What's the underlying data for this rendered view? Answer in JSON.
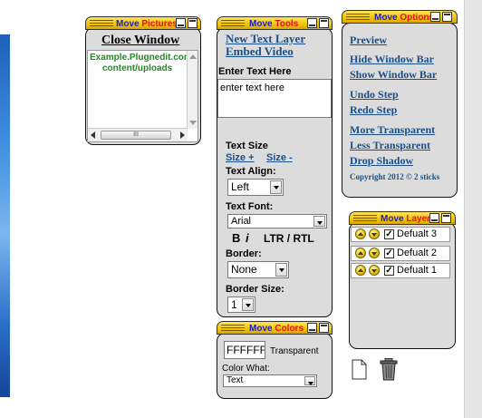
{
  "pictures_panel": {
    "title_move": "Move",
    "title_name": "Pictures",
    "close_window": "Close Window",
    "url_line1": "Example.Plugnedit.con",
    "url_line2": "content/uploads",
    "scroll_thumb": "III"
  },
  "tools_panel": {
    "title_move": "Move",
    "title_name": "Tools",
    "new_text_layer": "New Text Layer",
    "embed_video": "Embed Video",
    "enter_text_label": "Enter Text Here",
    "textarea_value": "enter text here",
    "text_size_label": "Text Size",
    "size_plus": "Size +",
    "size_minus": "Size -",
    "text_align_label": "Text Align:",
    "align_value": "Left",
    "text_font_label": "Text Font:",
    "font_value": "Arial",
    "bold": "B",
    "italic": "i",
    "ltr_rtl": "LTR / RTL",
    "border_label": "Border:",
    "border_value": "None",
    "border_size_label": "Border Size:",
    "border_size_value": "1"
  },
  "options_panel": {
    "title_move": "Move",
    "title_name": "Options",
    "items": [
      "Preview",
      "Hide Window Bar",
      "Show Window Bar",
      "Undo Step",
      "Redo Step",
      "More Transparent",
      "Less Transparent",
      "Drop Shadow"
    ],
    "copyright": "Copyright 2012 © 2 sticks"
  },
  "layers_panel": {
    "title_move": "Move",
    "title_name": "Layers",
    "layers": [
      {
        "name": "Defualt 3",
        "checked": "✓"
      },
      {
        "name": "Defualt 2",
        "checked": "✓"
      },
      {
        "name": "Defualt 1",
        "checked": "✓"
      }
    ]
  },
  "colors_panel": {
    "title_move": "Move",
    "title_name": "Colors",
    "color_value": "FFFFFF",
    "transparent_label": "Transparent",
    "color_what_label": "Color What:",
    "color_what_value": "Text"
  },
  "icons": {
    "new_page": "new-page-icon",
    "trash": "trash-icon"
  }
}
